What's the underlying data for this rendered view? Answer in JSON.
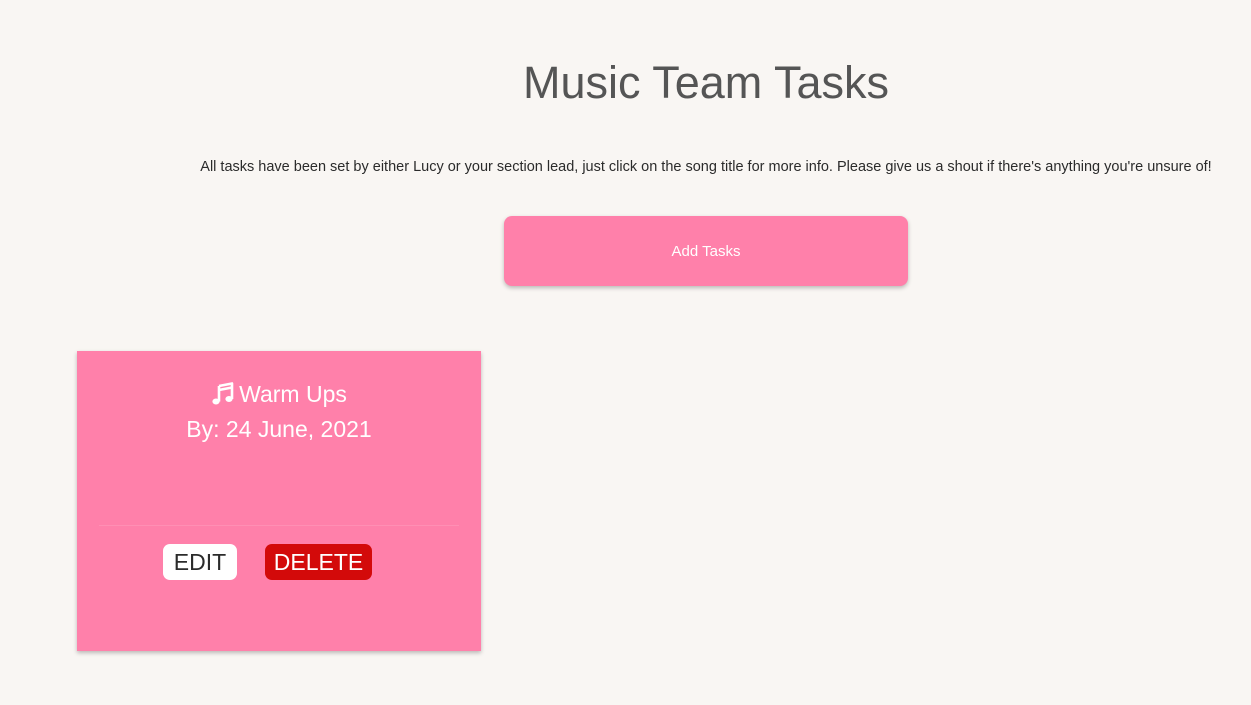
{
  "page": {
    "title": "Music Team Tasks",
    "intro": "All tasks have been set by either Lucy or your section lead, just click on the song title for more info. Please give us a shout if there's anything you're unsure of!",
    "add_tasks_label": "Add Tasks"
  },
  "tasks": [
    {
      "icon": "music-note-icon",
      "title": "Warm Ups",
      "due": "By: 24 June, 2021",
      "edit_label": "EDIT",
      "delete_label": "DELETE"
    }
  ],
  "colors": {
    "background": "#f9f6f3",
    "accent_pink": "#ff80aa",
    "delete_red": "#d30a0a",
    "title_gray": "#555555"
  }
}
